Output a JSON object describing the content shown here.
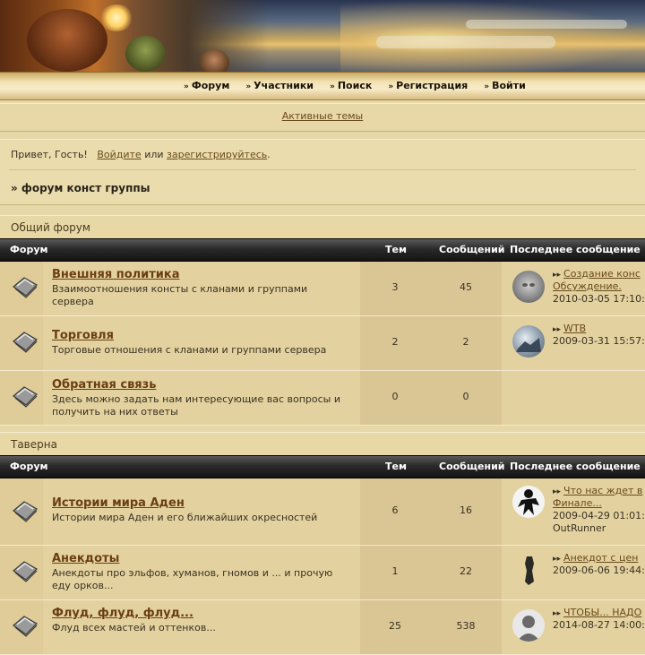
{
  "nav": {
    "items": [
      {
        "label": "Форум",
        "icon": "double-chevron-icon"
      },
      {
        "label": "Участники",
        "icon": "double-chevron-icon"
      },
      {
        "label": "Поиск",
        "icon": "double-chevron-icon"
      },
      {
        "label": "Регистрация",
        "icon": "double-chevron-icon"
      },
      {
        "label": "Войти",
        "icon": "double-chevron-icon"
      }
    ]
  },
  "active_topics": "Активные темы",
  "greeting": {
    "prefix": "Привет, Гость!",
    "login_link": "Войдите",
    "or": "или",
    "register_link": "зарегистрируйтесь",
    "suffix": "."
  },
  "breadcrumb": "» форум конст группы",
  "table_headers": {
    "forum": "Форум",
    "topics": "Тем",
    "posts": "Сообщений",
    "last_post": "Последнее сообщение"
  },
  "categories": [
    {
      "title": "Общий форум",
      "forums": [
        {
          "name": "Внешняя политика",
          "description": "Взаимоотношения консты с кланами и группами сервера",
          "topics": "3",
          "posts": "45",
          "last_post": {
            "title": "Создание конс",
            "title2": "Обсуждение.",
            "date": "2010-03-05 17:10:",
            "author": "",
            "avatar": "grey-face-avatar"
          }
        },
        {
          "name": "Торговля",
          "description": "Торговые отношения с кланами и группами сервера",
          "topics": "2",
          "posts": "2",
          "last_post": {
            "title": "WTB",
            "title2": "",
            "date": "2009-03-31 15:57:",
            "author": "",
            "avatar": "winter-scene-avatar"
          }
        },
        {
          "name": "Обратная связь",
          "description": "Здесь можно задать нам интересующие вас вопросы и получить на них ответы",
          "topics": "0",
          "posts": "0",
          "last_post": null
        }
      ]
    },
    {
      "title": "Таверна",
      "forums": [
        {
          "name": "Истории мира Аден",
          "description": "Истории мира Аден и его ближайших окресностей",
          "topics": "6",
          "posts": "16",
          "last_post": {
            "title": "Что нас ждет в",
            "title2": "Финале...",
            "date": "2009-04-29 01:01:",
            "author": "OutRunner",
            "avatar": "ninja-silhouette-avatar"
          }
        },
        {
          "name": "Анекдоты",
          "description": "Анекдоты про эльфов, хуманов, гномов и ... и прочую еду орков...",
          "topics": "1",
          "posts": "22",
          "last_post": {
            "title": "Анекдот с цен",
            "title2": "",
            "date": "2009-06-06 19:44:",
            "author": "",
            "avatar": "dark-figure-avatar"
          }
        },
        {
          "name": "Флуд, флуд, флуд...",
          "description": "Флуд всех мастей и оттенков...",
          "topics": "25",
          "posts": "538",
          "last_post": {
            "title": "ЧТОБЫ... НАДО",
            "title2": "",
            "date": "2014-08-27 14:00:",
            "author": "",
            "avatar": "default-user-avatar"
          }
        }
      ]
    }
  ],
  "colors": {
    "link": "#6a4a1a",
    "forum_title": "#6a3e12",
    "header_bar": "#1a1a1a",
    "background": "#e6d8a8"
  }
}
